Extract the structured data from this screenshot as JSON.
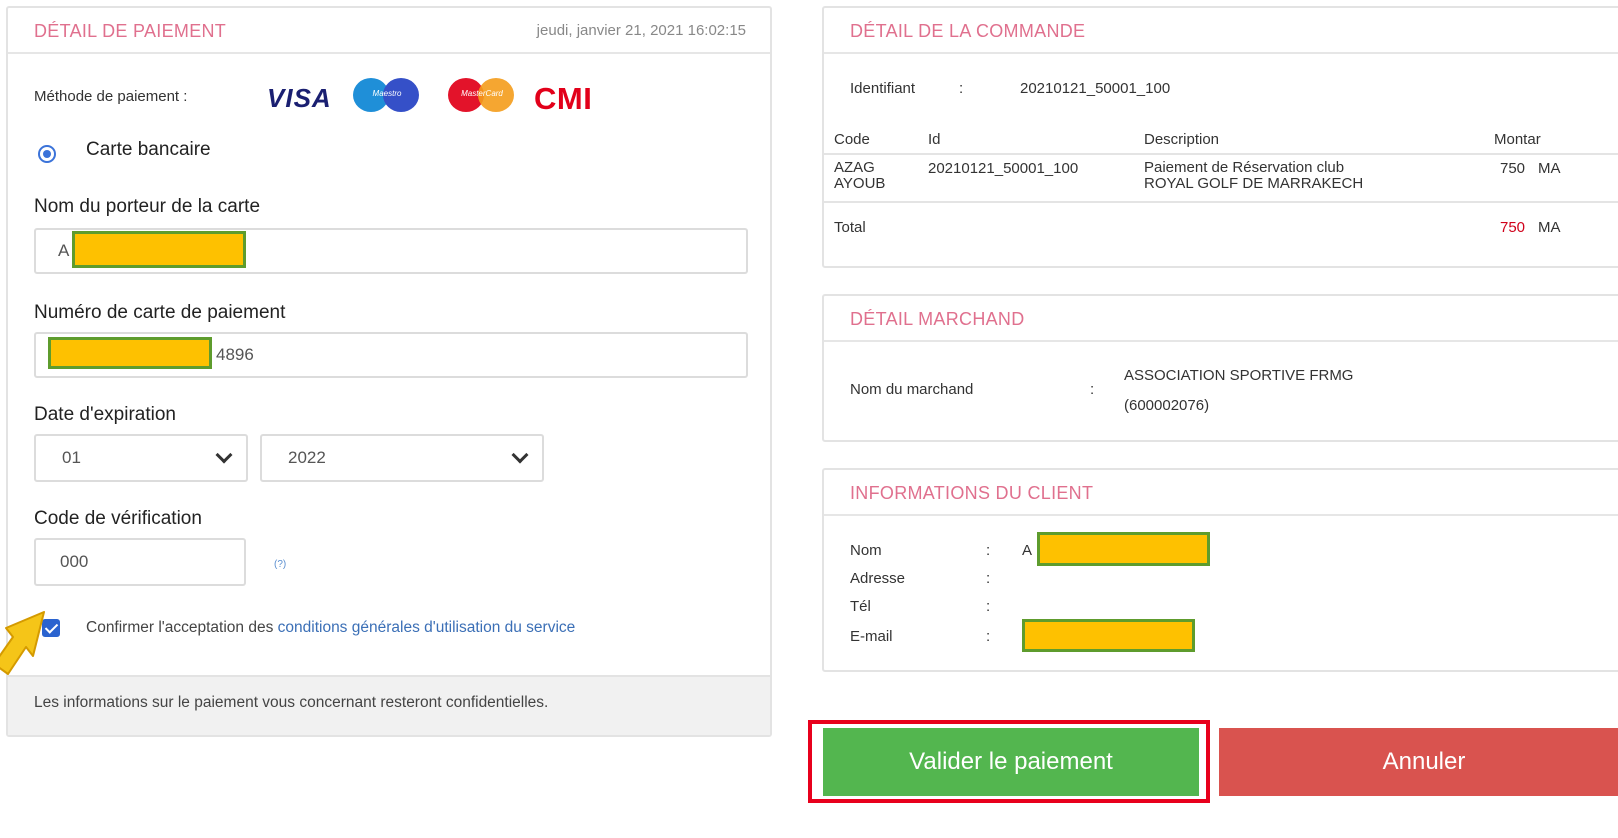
{
  "payment": {
    "title": "DÉTAIL DE PAIEMENT",
    "datetime": "jeudi, janvier 21, 2021 16:02:15",
    "method_label": "Méthode de paiement :",
    "logos": {
      "visa": "VISA",
      "maestro": "Maestro",
      "mastercard": "MasterCard",
      "cmi": "CMI"
    },
    "card_type": "Carte bancaire",
    "holder_label": "Nom du porteur de la carte",
    "holder_value": "A",
    "number_label": "Numéro de carte de paiement",
    "number_value": "4896",
    "expiry_label": "Date d'expiration",
    "expiry_month": "01",
    "expiry_year": "2022",
    "cvv_label": "Code de vérification",
    "cvv_value": "000",
    "cvv_help": "(?)",
    "terms_prefix": "Confirmer l'acceptation des",
    "terms_link": "conditions générales d'utilisation du service",
    "footer_note": "Les informations sur le paiement vous concernant resteront confidentielles."
  },
  "order": {
    "title": "DÉTAIL DE LA COMMANDE",
    "id_label": "Identifiant",
    "sep": ":",
    "id_value": "20210121_50001_100",
    "columns": {
      "code": "Code",
      "id": "Id",
      "description": "Description",
      "amount": "Montar"
    },
    "row": {
      "code_line1": "AZAG",
      "code_line2": "AYOUB",
      "id": "20210121_50001_100",
      "desc_line1": "Paiement de Réservation club",
      "desc_line2": "ROYAL GOLF DE MARRAKECH",
      "amount": "750",
      "currency": "MA"
    },
    "total_label": "Total",
    "total_amount": "750",
    "total_currency": "MA"
  },
  "merchant": {
    "title": "DÉTAIL MARCHAND",
    "name_label": "Nom du marchand",
    "sep": ":",
    "name_line1": "ASSOCIATION SPORTIVE FRMG",
    "name_line2": "(600002076)"
  },
  "client": {
    "title": "INFORMATIONS DU CLIENT",
    "sep": ":",
    "name_label": "Nom",
    "name_value": "A",
    "address_label": "Adresse",
    "phone_label": "Tél",
    "email_label": "E-mail"
  },
  "actions": {
    "validate": "Valider le paiement",
    "cancel": "Annuler"
  },
  "colors": {
    "accent_title": "#e0708e",
    "validate_bg": "#53b64f",
    "cancel_bg": "#d9534f",
    "mask": "#fec100",
    "highlight_frame": "#e8001c",
    "pointer_arrow": "#f5c518"
  }
}
